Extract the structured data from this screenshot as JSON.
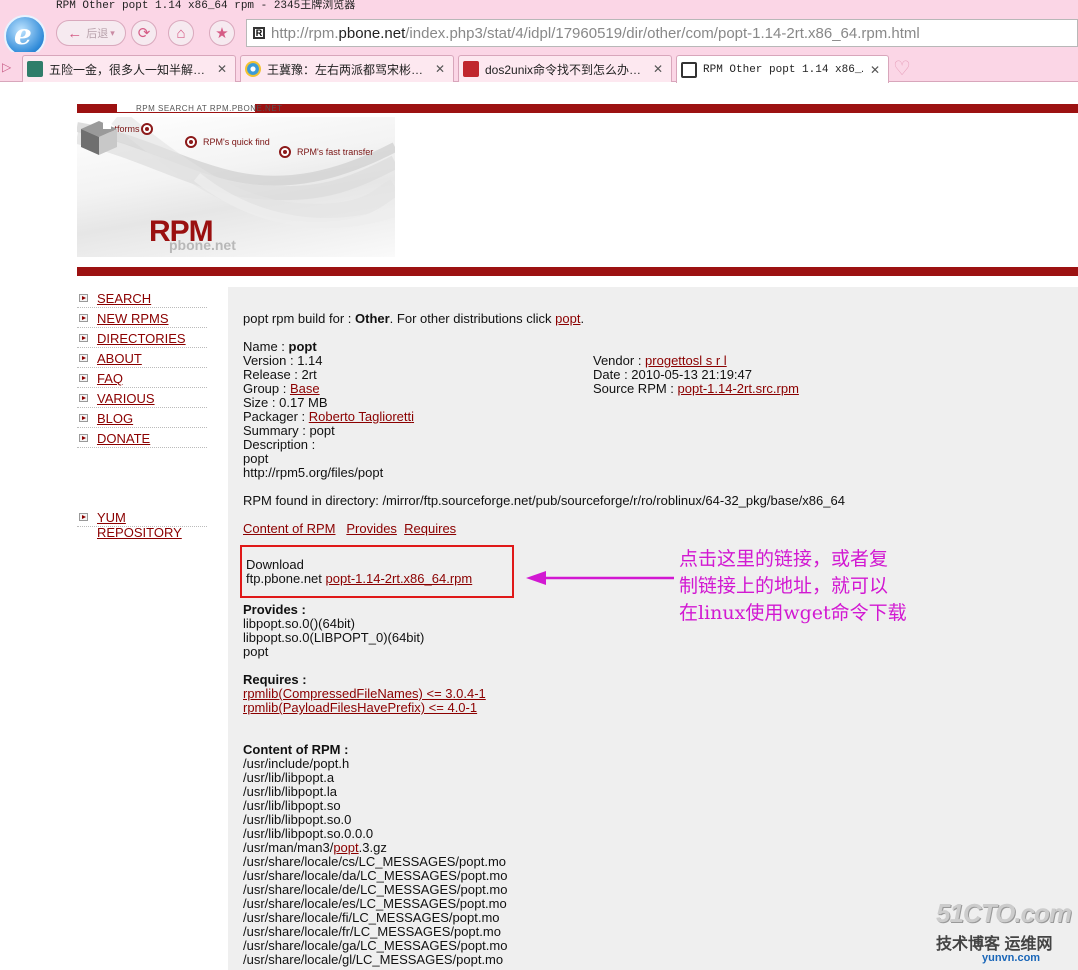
{
  "window": {
    "title": "RPM Other popt 1.14 x86_64 rpm - 2345王牌浏览器"
  },
  "toolbar": {
    "back_label": "后退",
    "url_prefix": "http://rpm.",
    "url_domain": "pbone.net",
    "url_path": "/index.php3/stat/4/idpl/17960519/dir/other/com/popt-1.14-2rt.x86_64.rpm.html"
  },
  "tabs": [
    {
      "label": "五险一金，很多人一知半解…",
      "icon_color": "#2f7d6a"
    },
    {
      "label": "王冀豫：左右两派都骂宋彬…",
      "icon_color": "#3b9bd6"
    },
    {
      "label": "dos2unix命令找不到怎么办…",
      "icon_color": "#c0262d"
    },
    {
      "label": "RPM Other popt 1.14 x86_…",
      "icon_color": "#8b0000"
    }
  ],
  "header": {
    "site_tag": "RPM SEARCH AT RPM.PBONE.NET",
    "banner_labels": [
      "all platforms",
      "RPM's quick find",
      "RPM's fast transfer"
    ],
    "logo_text": "RPM",
    "logo_sub": "pbone.net"
  },
  "sidebar": {
    "items": [
      "SEARCH",
      "NEW RPMS",
      "DIRECTORIES",
      "ABOUT",
      "FAQ",
      "VARIOUS",
      "BLOG",
      "DONATE"
    ],
    "yum": "YUM REPOSITORY"
  },
  "content": {
    "intro_prefix": "popt rpm build for : ",
    "intro_bold": "Other",
    "intro_mid": ". For other distributions click ",
    "intro_link": "popt",
    "intro_end": ".",
    "name_label": "Name : ",
    "name_value": "popt",
    "version": "Version : 1.14",
    "release": "Release : 2rt",
    "group_label": "Group : ",
    "group_value": "Base",
    "size": "Size : 0.17 MB",
    "packager_label": "Packager : ",
    "packager_value": "Roberto Tagliorett",
    "packager_tail": "i",
    "summary": "Summary : popt",
    "description": "Description :",
    "desc_line1": "popt",
    "desc_line2": "http://rpm5.org/files/popt",
    "vendor_label": "Vendor : ",
    "vendor_value": "progettosl s r l",
    "date": "Date : 2010-05-13 21:19:47",
    "source_label": "Source RPM : ",
    "source_value": "popt-1.14-2rt.src.rpm",
    "found_dir": "RPM found in directory: /mirror/ftp.sourceforge.net/pub/sourceforge/r/ro/roblinux/64-32_pkg/base/x86_64",
    "links": [
      "Content of RPM",
      "Provides",
      "Requires"
    ],
    "download_title": "Download",
    "download_host": "ftp.pbone.net ",
    "download_file": "popt-1.14-2rt.x86_64.rpm",
    "provides_title": "Provides :",
    "provides": [
      "libpopt.so.0()(64bit)",
      "libpopt.so.0(LIBPOPT_0)(64bit)",
      "popt"
    ],
    "requires_title": "Requires :",
    "requires": [
      "rpmlib(CompressedFileNames) <= 3.0.4-1",
      "rpmlib(PayloadFilesHavePrefix) <= 4.0-1"
    ],
    "content_title": "Content of RPM :",
    "files_before": [
      "/usr/include/popt.h",
      "/usr/lib/libpopt.a",
      "/usr/lib/libpopt.la",
      "/usr/lib/libpopt.so",
      "/usr/lib/libpopt.so.0",
      "/usr/lib/libpopt.so.0.0.0"
    ],
    "man_prefix": "/usr/man/man3/",
    "man_link": "popt",
    "man_suffix": ".3.gz",
    "files_after": [
      "/usr/share/locale/cs/LC_MESSAGES/popt.mo",
      "/usr/share/locale/da/LC_MESSAGES/popt.mo",
      "/usr/share/locale/de/LC_MESSAGES/popt.mo",
      "/usr/share/locale/es/LC_MESSAGES/popt.mo",
      "/usr/share/locale/fi/LC_MESSAGES/popt.mo",
      "/usr/share/locale/fr/LC_MESSAGES/popt.mo",
      "/usr/share/locale/ga/LC_MESSAGES/popt.mo",
      "/usr/share/locale/gl/LC_MESSAGES/popt.mo"
    ]
  },
  "annotation": {
    "lines": [
      "点击这里的链接，或者复",
      "制链接上的地址，就可以",
      "在linux使用wget命令下载"
    ],
    "color": "#d218d2"
  },
  "watermark": {
    "brand": "51CTO.com",
    "sub": "技术博客 运维网",
    "url": "yunvn.com"
  }
}
